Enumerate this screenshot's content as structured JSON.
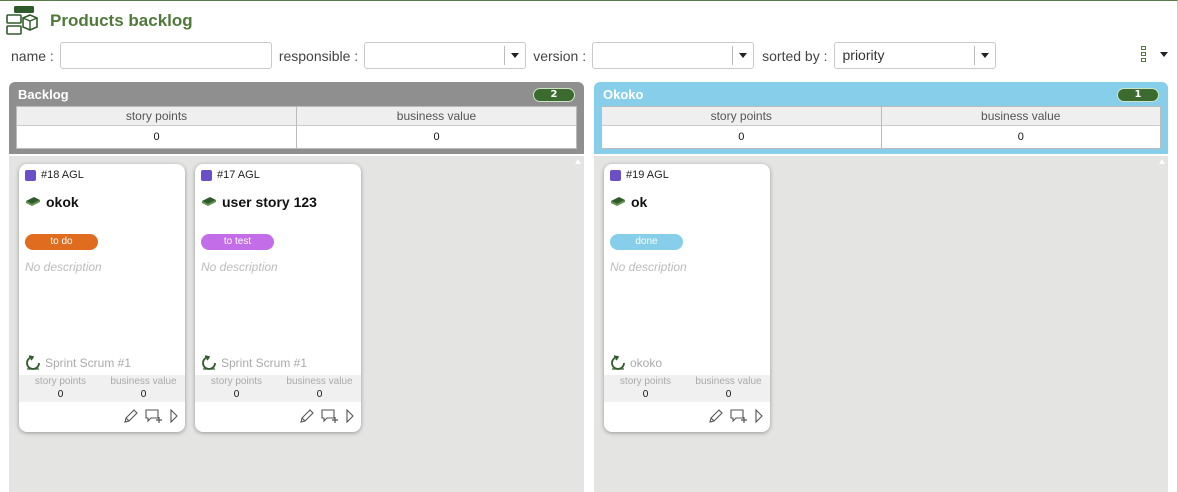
{
  "header": {
    "title": "Products backlog"
  },
  "filters": {
    "name_label": "name :",
    "name_value": "",
    "responsible_label": "responsible :",
    "responsible_value": "",
    "version_label": "version :",
    "version_value": "",
    "sorted_label": "sorted by :",
    "sorted_value": "priority"
  },
  "columns": [
    {
      "title": "Backlog",
      "count": "2",
      "color": "#8f8f8f",
      "stats": {
        "sp_label": "story points",
        "sp_value": "0",
        "bv_label": "business value",
        "bv_value": "0"
      },
      "cards": [
        {
          "id": "#18 AGL",
          "name": "okok",
          "status": "to do",
          "status_color": "#e06d1f",
          "description": "No description",
          "sprint": "Sprint Scrum #1",
          "sp_label": "story points",
          "sp_value": "0",
          "bv_label": "business value",
          "bv_value": "0"
        },
        {
          "id": "#17 AGL",
          "name": "user story 123",
          "status": "to test",
          "status_color": "#c36de8",
          "description": "No description",
          "sprint": "Sprint Scrum #1",
          "sp_label": "story points",
          "sp_value": "0",
          "bv_label": "business value",
          "bv_value": "0"
        }
      ]
    },
    {
      "title": "Okoko",
      "count": "1",
      "color": "#87ceeb",
      "stats": {
        "sp_label": "story points",
        "sp_value": "0",
        "bv_label": "business value",
        "bv_value": "0"
      },
      "cards": [
        {
          "id": "#19 AGL",
          "name": "ok",
          "status": "done",
          "status_color": "#87ceeb",
          "description": "No description",
          "sprint": "okoko",
          "sp_label": "story points",
          "sp_value": "0",
          "bv_label": "business value",
          "bv_value": "0"
        }
      ]
    }
  ],
  "icons": {
    "logo": "backlog-icon",
    "story": "book-icon",
    "sprint": "sprint-cycle-icon",
    "edit": "pencil-icon",
    "comment": "add-comment-icon",
    "open": "play-icon",
    "view": "view-toggle-icon"
  },
  "colors": {
    "accent": "#4f7a3a",
    "story_type": "#6a4fc7",
    "board_bg": "#e4e5e3"
  }
}
